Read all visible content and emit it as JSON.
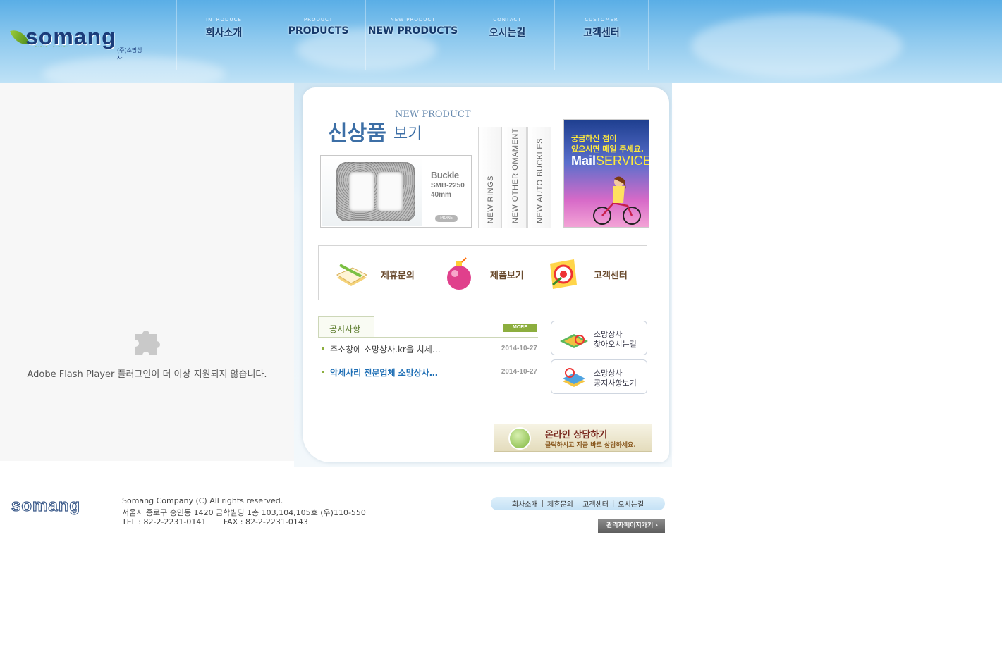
{
  "header": {
    "logo_text": "somang",
    "logo_sub": "(주)소망상사",
    "nav": [
      {
        "en": "INTRODUCE",
        "ko": "회사소개"
      },
      {
        "en": "PRODUCT",
        "ko": "PRODUCTS"
      },
      {
        "en": "NEW PRODUCT",
        "ko": "NEW PRODUCTS"
      },
      {
        "en": "CONTACT",
        "ko": "오시는길"
      },
      {
        "en": "CUSTOMER",
        "ko": "고객센터"
      }
    ]
  },
  "flash": {
    "message": "Adobe Flash Player 플러그인이 더 이상 지원되지 않습니다."
  },
  "new_product": {
    "heading_en": "NEW PRODUCT",
    "heading_ko": "신상품",
    "heading_ko2": "보기",
    "item": {
      "name": "Buckle",
      "model": "SMB-2250",
      "size": "40mm",
      "more": "MORE"
    },
    "tabs": [
      "NEW RINGS",
      "NEW OTHER OMAMENT",
      "NEW AUTO BUCKLES"
    ]
  },
  "mail_banner": {
    "line1": "궁금하신 점이",
    "line2": "있으시면 메일 주세요.",
    "mail": "Mail",
    "service": "SERVICE"
  },
  "quick_links": [
    {
      "label": "제휴문의",
      "icon": "notebook-pencil-icon"
    },
    {
      "label": "제품보기",
      "icon": "ball-ornament-icon"
    },
    {
      "label": "고객센터",
      "icon": "target-dart-icon"
    }
  ],
  "notice": {
    "title": "공지사항",
    "more": "MORE",
    "items": [
      {
        "title": "주소창에 소망상사.kr을 치세…",
        "date": "2014-10-27"
      },
      {
        "title": "악세사리 전문업체 소망상사…",
        "date": "2014-10-27"
      }
    ]
  },
  "side_buttons": [
    {
      "line1": "소망상사",
      "line2": "찾아오시는길",
      "icon": "map-magnifier-icon"
    },
    {
      "line1": "소망상사",
      "line2": "공지사항보기",
      "icon": "books-magnifier-icon"
    }
  ],
  "consult": {
    "title": "온라인 상담하기",
    "subtitle": "클릭하시고 지금 바로 상담하세요."
  },
  "footer": {
    "logo_text": "somang",
    "copyright": "Somang Company (C) All rights reserved.",
    "address": "서울시 종로구 숭인동 1420 금학빌딩 1층 103,104,105호  (우)110-550",
    "contact": "TEL : 82-2-2231-0141       FAX : 82-2-2231-0143",
    "links": [
      "회사소개",
      "제휴문의",
      "고객센터",
      "오시는길"
    ],
    "admin": "관리자페이지가기"
  },
  "colors": {
    "header_sky": "#8cc8ee",
    "nav_text": "#15396b",
    "accent_blue": "#3d6fa6",
    "notice_green": "#8cae3e",
    "highlight_notice": "#1f6fb5"
  }
}
